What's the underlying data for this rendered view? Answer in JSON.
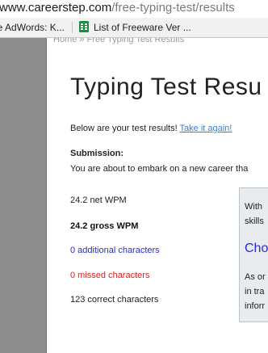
{
  "browser": {
    "url_domain": "www.careerstep.com",
    "url_path": "/free-typing-test/results",
    "bookmarks": [
      {
        "label": "le AdWords: K..."
      },
      {
        "label": "List of Freeware Ver ..."
      }
    ]
  },
  "page": {
    "breadcrumb": "Home » Free Typing Test Results",
    "title": "Typing Test Resu",
    "intro_text": "Below are your test results! ",
    "retake_link": "Take it again!",
    "submission_label": "Submission:",
    "submission_text": "You are about to embark on a new career tha",
    "stats": {
      "net_wpm": "24.2 net WPM",
      "gross_wpm": "24.2 gross WPM",
      "additional": "0 additional characters",
      "missed": "0 missed characters",
      "correct": "123 correct characters"
    },
    "sidebar": {
      "line1": "With",
      "line2": "skills",
      "heading": "Cho",
      "line3": "As or",
      "line4": "in tra",
      "line5": "inforr"
    }
  }
}
